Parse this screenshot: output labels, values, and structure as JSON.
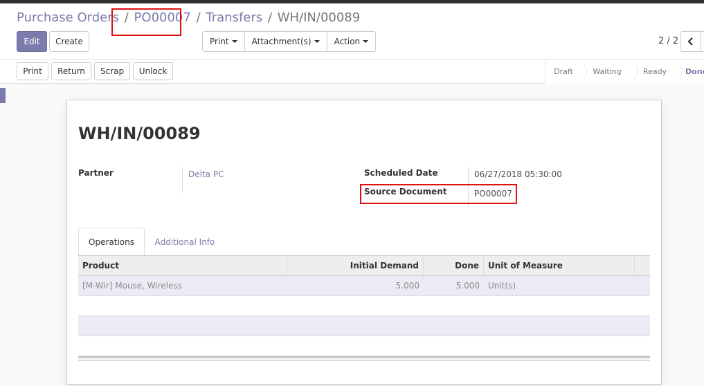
{
  "breadcrumb": {
    "items": [
      "Purchase Orders",
      "PO00007",
      "Transfers"
    ],
    "current": "WH/IN/00089",
    "separator": "/"
  },
  "toolbar": {
    "edit_label": "Edit",
    "create_label": "Create",
    "print_label": "Print",
    "attachments_label": "Attachment(s)",
    "action_label": "Action"
  },
  "pager": {
    "value": "2 / 2"
  },
  "statusbar": {
    "buttons": [
      "Print",
      "Return",
      "Scrap",
      "Unlock"
    ],
    "stages": [
      "Draft",
      "Waiting",
      "Ready",
      "Done"
    ],
    "current_stage": "Done"
  },
  "record": {
    "title": "WH/IN/00089",
    "partner_label": "Partner",
    "partner_value": "Delta PC",
    "scheduled_date_label": "Scheduled Date",
    "scheduled_date_value": "06/27/2018 05:30:00",
    "source_document_label": "Source Document",
    "source_document_value": "PO00007"
  },
  "tabs": [
    {
      "label": "Operations",
      "active": true
    },
    {
      "label": "Additional Info",
      "active": false
    }
  ],
  "operations": {
    "columns": [
      "Product",
      "Initial Demand",
      "Done",
      "Unit of Measure"
    ],
    "rows": [
      {
        "product": "[M-Wir] Mouse, Wireless",
        "initial_demand": "5.000",
        "done": "5.000",
        "uom": "Unit(s)"
      }
    ]
  },
  "colors": {
    "brand": "#7c7bad",
    "highlight": "#e01010",
    "topbar": "#2f3136"
  }
}
